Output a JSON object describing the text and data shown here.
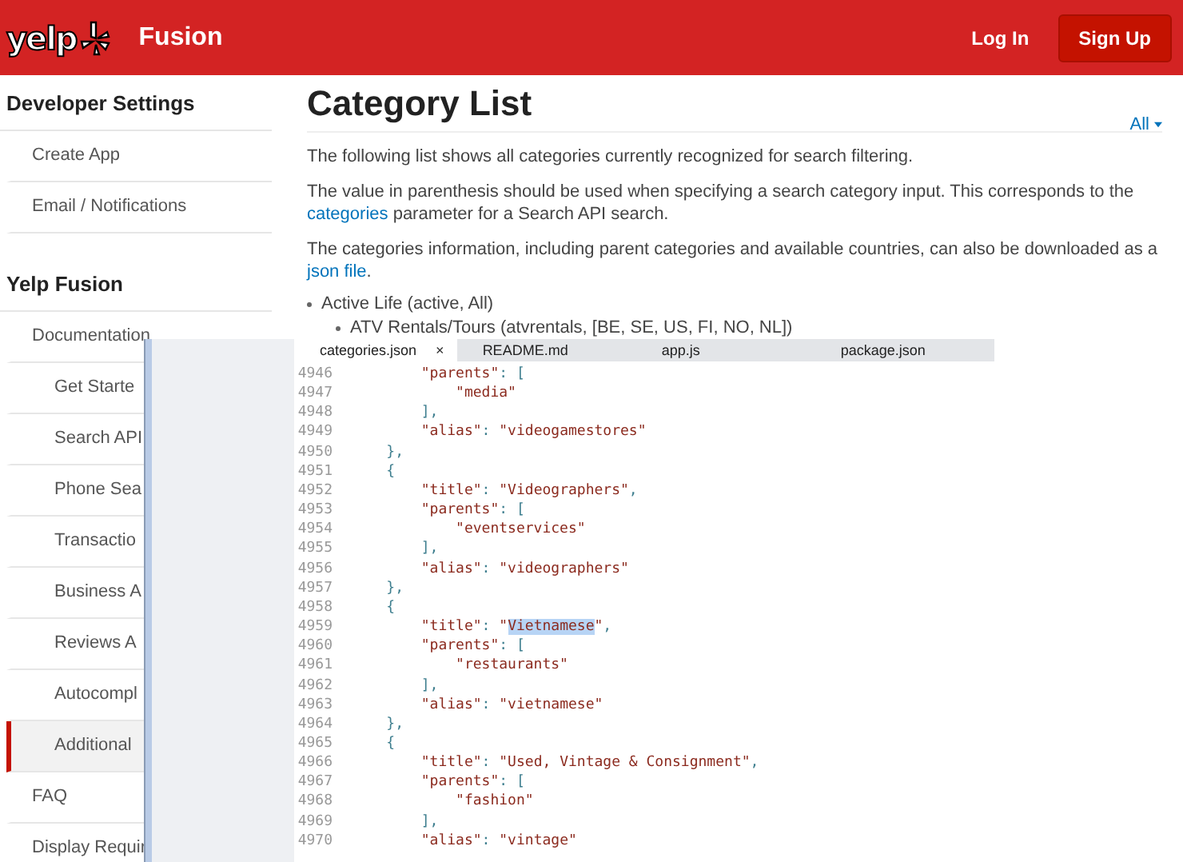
{
  "header": {
    "logo_text": "yelp",
    "product": "Fusion",
    "login": "Log In",
    "signup": "Sign Up"
  },
  "sidebar": [
    {
      "heading": "Developer Settings",
      "items": [
        {
          "label": "Create App",
          "selected": false
        },
        {
          "label": "Email / Notifications",
          "selected": false
        }
      ]
    },
    {
      "heading": "Yelp Fusion",
      "items": [
        {
          "label": "Documentation",
          "selected": false,
          "children": [
            {
              "label": "Get Starte",
              "selected": false
            },
            {
              "label": "Search API",
              "selected": false
            },
            {
              "label": "Phone Sea",
              "selected": false
            },
            {
              "label": "Transactio",
              "selected": false
            },
            {
              "label": "Business A",
              "selected": false
            },
            {
              "label": "Reviews A",
              "selected": false
            },
            {
              "label": "Autocompl",
              "selected": false
            },
            {
              "label": "Additional",
              "selected": true
            }
          ]
        },
        {
          "label": "FAQ",
          "selected": false
        },
        {
          "label": "Display Requir",
          "selected": false
        }
      ]
    }
  ],
  "main": {
    "title": "Category List",
    "filter": "All",
    "paragraphs": [
      [
        {
          "text": "The following list shows all categories currently recognized for search filtering.",
          "kind": "text"
        }
      ],
      [
        {
          "text": "The value in parenthesis should be used when specifying a search category input. This corresponds to the ",
          "kind": "text"
        },
        {
          "text": "categories",
          "kind": "link"
        },
        {
          "text": " parameter for a Search API search.",
          "kind": "text"
        }
      ],
      [
        {
          "text": "The categories information, including parent categories and available countries, can also be downloaded as a ",
          "kind": "text"
        },
        {
          "text": "json file",
          "kind": "link"
        },
        {
          "text": ".",
          "kind": "text"
        }
      ]
    ],
    "categories": [
      {
        "label": "Active Life (active, All)",
        "children": [
          {
            "label": "ATV Rentals/Tours (atvrentals, [BE, SE, US, FI, NO, NL])"
          }
        ]
      }
    ]
  },
  "editor": {
    "tabs": [
      {
        "label": "categories.json",
        "selected": true,
        "close": "×"
      },
      {
        "label": "README.md",
        "selected": false
      },
      {
        "label": "app.js",
        "selected": false
      },
      {
        "label": "package.json",
        "selected": false
      }
    ],
    "lines": [
      {
        "number": "4946",
        "segments": [
          {
            "text": "        \"parents\": [",
            "selected": false
          }
        ]
      },
      {
        "number": "4947",
        "segments": [
          {
            "text": "            \"media\"",
            "selected": false
          }
        ]
      },
      {
        "number": "4948",
        "segments": [
          {
            "text": "        ],",
            "selected": false
          }
        ]
      },
      {
        "number": "4949",
        "segments": [
          {
            "text": "        \"alias\": \"videogamestores\"",
            "selected": false
          }
        ]
      },
      {
        "number": "4950",
        "segments": [
          {
            "text": "    },",
            "selected": false
          }
        ]
      },
      {
        "number": "4951",
        "segments": [
          {
            "text": "    {",
            "selected": false
          }
        ]
      },
      {
        "number": "4952",
        "segments": [
          {
            "text": "        \"title\": \"Videographers\",",
            "selected": false
          }
        ]
      },
      {
        "number": "4953",
        "segments": [
          {
            "text": "        \"parents\": [",
            "selected": false
          }
        ]
      },
      {
        "number": "4954",
        "segments": [
          {
            "text": "            \"eventservices\"",
            "selected": false
          }
        ]
      },
      {
        "number": "4955",
        "segments": [
          {
            "text": "        ],",
            "selected": false
          }
        ]
      },
      {
        "number": "4956",
        "segments": [
          {
            "text": "        \"alias\": \"videographers\"",
            "selected": false
          }
        ]
      },
      {
        "number": "4957",
        "segments": [
          {
            "text": "    },",
            "selected": false
          }
        ]
      },
      {
        "number": "4958",
        "segments": [
          {
            "text": "    {",
            "selected": false
          }
        ]
      },
      {
        "number": "4959",
        "segments": [
          {
            "text": "        \"title\": \"",
            "selected": false
          },
          {
            "text": "Vietnamese",
            "selected": true
          },
          {
            "text": "\",",
            "selected": false
          }
        ]
      },
      {
        "number": "4960",
        "segments": [
          {
            "text": "        \"parents\": [",
            "selected": false
          }
        ]
      },
      {
        "number": "4961",
        "segments": [
          {
            "text": "            \"restaurants\"",
            "selected": false
          }
        ]
      },
      {
        "number": "4962",
        "segments": [
          {
            "text": "        ],",
            "selected": false
          }
        ]
      },
      {
        "number": "4963",
        "segments": [
          {
            "text": "        \"alias\": \"vietnamese\"",
            "selected": false
          }
        ]
      },
      {
        "number": "4964",
        "segments": [
          {
            "text": "    },",
            "selected": false
          }
        ]
      },
      {
        "number": "4965",
        "segments": [
          {
            "text": "    {",
            "selected": false
          }
        ]
      },
      {
        "number": "4966",
        "segments": [
          {
            "text": "        \"title\": \"Used, Vintage & Consignment\",",
            "selected": false
          }
        ]
      },
      {
        "number": "4967",
        "segments": [
          {
            "text": "        \"parents\": [",
            "selected": false
          }
        ]
      },
      {
        "number": "4968",
        "segments": [
          {
            "text": "            \"fashion\"",
            "selected": false
          }
        ]
      },
      {
        "number": "4969",
        "segments": [
          {
            "text": "        ],",
            "selected": false
          }
        ]
      },
      {
        "number": "4970",
        "segments": [
          {
            "text": "        \"alias\": \"vintage\"",
            "selected": false
          }
        ]
      }
    ]
  }
}
